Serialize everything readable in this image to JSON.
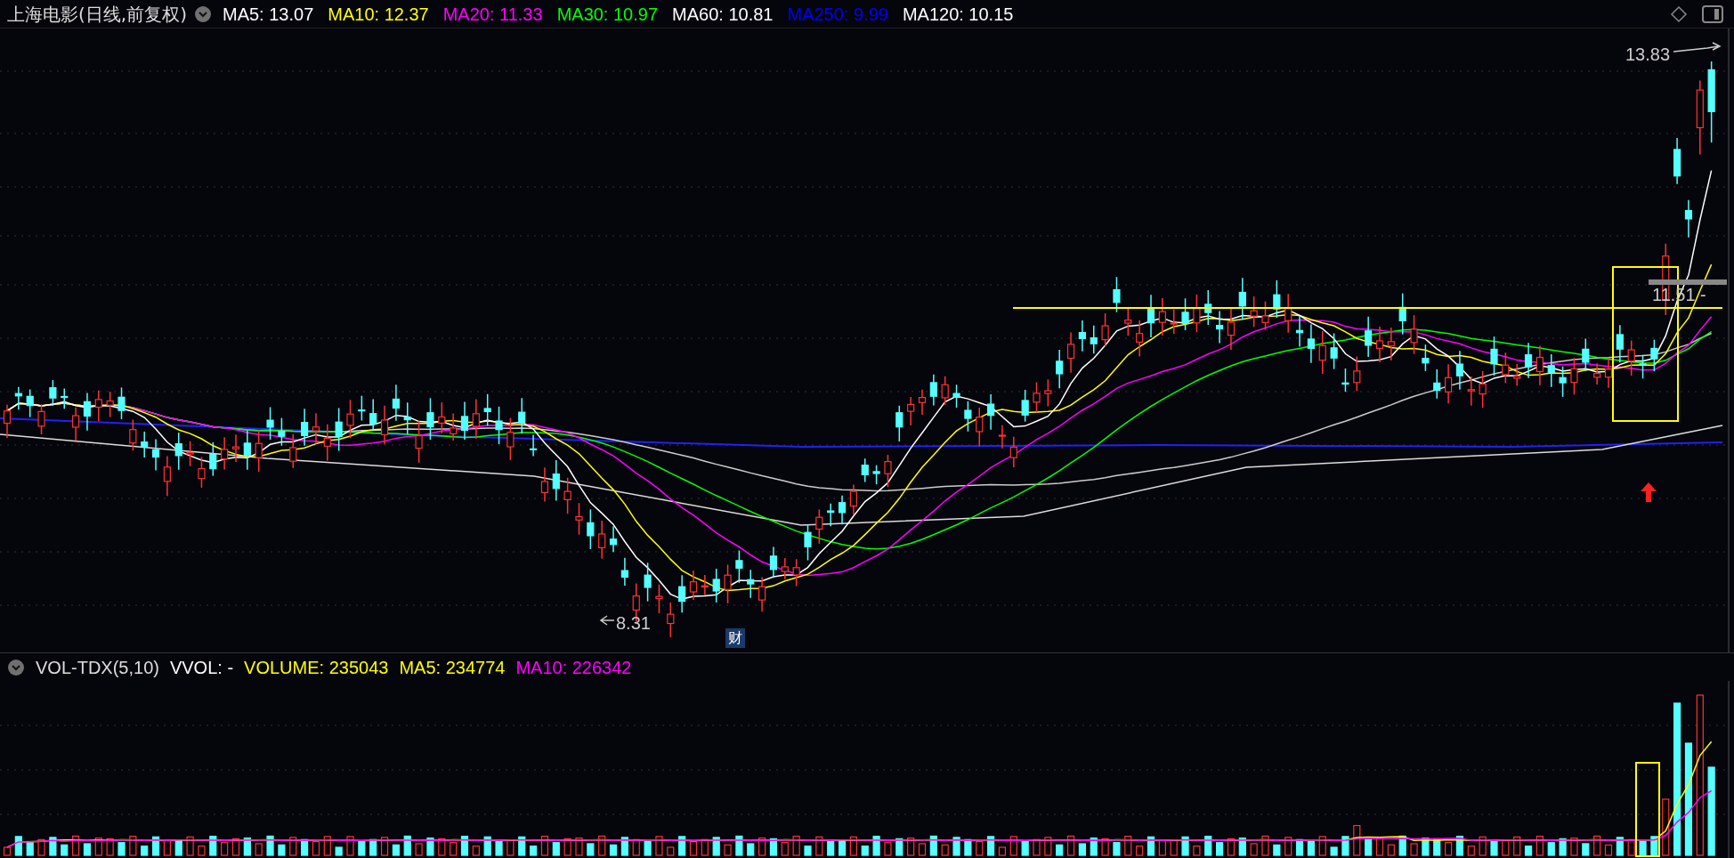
{
  "header": {
    "title": "上海电影(日线,前复权)",
    "indicators": [
      {
        "label": "MA5: 13.07",
        "color": "#ffffff"
      },
      {
        "label": "MA10: 12.37",
        "color": "#ffff00"
      },
      {
        "label": "MA20: 11.33",
        "color": "#ff00ff"
      },
      {
        "label": "MA30: 10.97",
        "color": "#00ff00"
      },
      {
        "label": "MA60: 10.81",
        "color": "#ffffff"
      },
      {
        "label": "MA250: 9.99",
        "color": "#0000ff"
      },
      {
        "label": "MA120: 10.15",
        "color": "#ffffff"
      }
    ]
  },
  "chart": {
    "high_label": "13.83",
    "low_label": "8.31",
    "price_tag": "11.51 -",
    "event_badge": "财"
  },
  "volume": {
    "title": "VOL-TDX(5,10)",
    "indicators": [
      {
        "label": "VVOL: -",
        "color": "#ffffff"
      },
      {
        "label": "VOLUME: 235043",
        "color": "#ffff00"
      },
      {
        "label": "MA5: 234774",
        "color": "#ffff00"
      },
      {
        "label": "MA10: 226342",
        "color": "#ff00ff"
      }
    ]
  }
}
